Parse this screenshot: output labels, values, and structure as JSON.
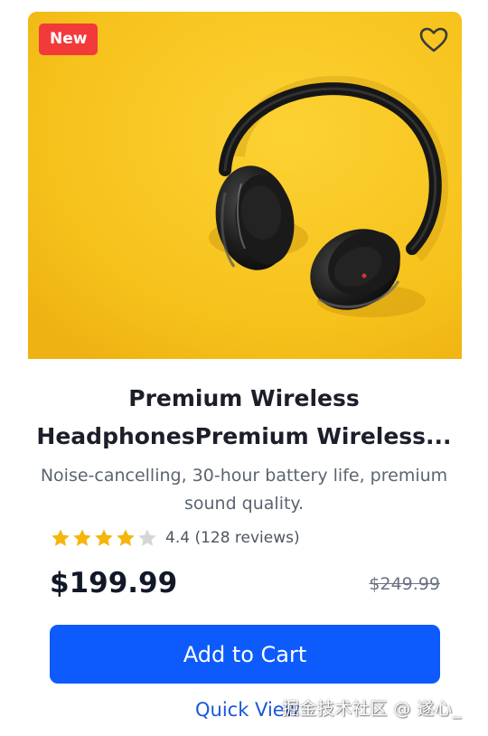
{
  "product": {
    "badge": "New",
    "image_alt": "headphones-photo",
    "title_line1": "Premium Wireless",
    "title_line2": "HeadphonesPremium Wireless...",
    "description": "Noise-cancelling, 30-hour battery life, premium sound quality.",
    "rating_value": 4.4,
    "rating_text": "4.4 (128 reviews)",
    "stars_filled": 4,
    "stars_total": 5,
    "price": "$199.99",
    "original_price": "$249.99"
  },
  "actions": {
    "add_to_cart_label": "Add to Cart",
    "quick_view_label": "Quick View",
    "favorite_icon": "heart-icon"
  },
  "watermark": "掘金技术社区 @ 遂心_",
  "colors": {
    "accent": "#0d5bfd",
    "badge": "#f23a3a",
    "star_filled": "#f5b50a",
    "star_empty": "#d6d6d6",
    "image_background": "#f6c21c"
  }
}
